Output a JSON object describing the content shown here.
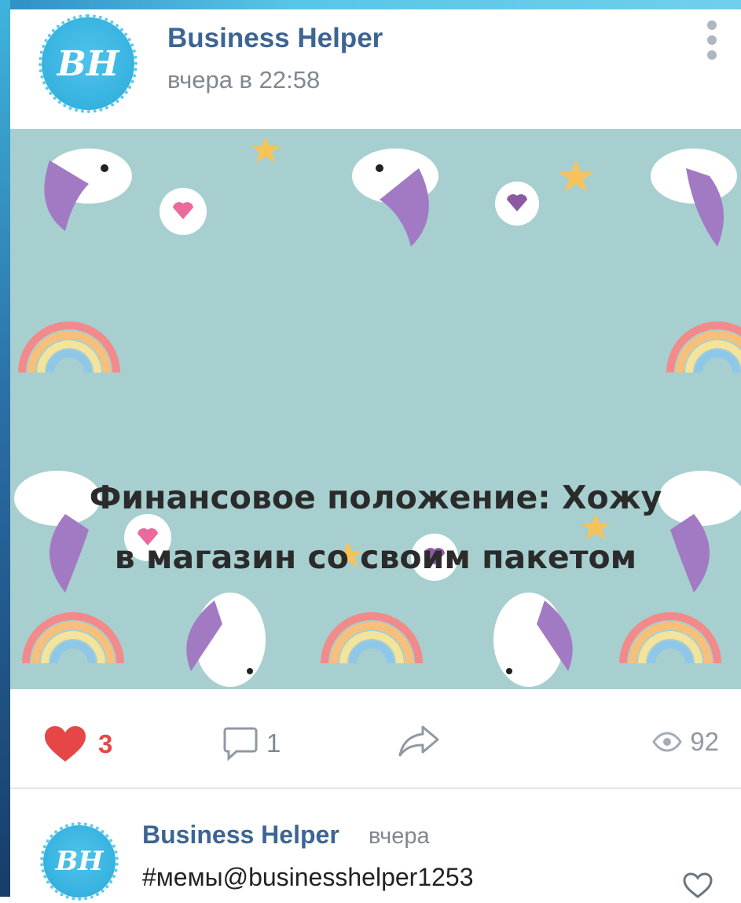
{
  "post": {
    "author": "Business Helper",
    "time": "вчера в 22:58",
    "avatar_text": "BH",
    "image_caption_line1": "Финансовое положение: Хожу",
    "image_caption_line2": "в магазин со своим пакетом",
    "actions": {
      "likes": "3",
      "comments": "1",
      "views": "92"
    }
  },
  "comment": {
    "author": "Business Helper",
    "time": "вчера",
    "text": "#мемы@businesshelper1253",
    "avatar_text": "BH"
  },
  "icons": {
    "more": "more-vertical-icon",
    "like": "heart-icon",
    "comment": "comment-icon",
    "share": "share-icon",
    "views": "eye-icon",
    "comment_like": "heart-outline-icon"
  },
  "colors": {
    "link_blue": "#3d6593",
    "like_red": "#e64646",
    "muted": "#7f8891",
    "image_bg": "#a7cfcf"
  }
}
